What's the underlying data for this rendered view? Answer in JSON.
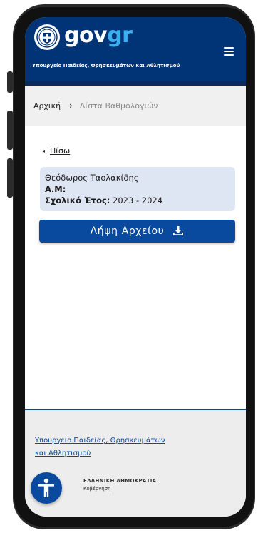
{
  "header": {
    "logo_gov": "gov",
    "logo_gr": "gr",
    "ministry_title": "Υπουργείο Παιδείας, Θρησκευμάτων και Αθλητισμού"
  },
  "breadcrumb": {
    "home": "Αρχική",
    "separator": "›",
    "current": "Λίστα Βαθμολογιών"
  },
  "back": {
    "arrow": "◂",
    "label": "Πίσω"
  },
  "student": {
    "name": "Θεόδωρος Ταολακίδης",
    "am_label": "Α.Μ:",
    "am_value": "",
    "year_label": "Σχολικό Έτος:",
    "year_value": "2023 - 2024"
  },
  "download": {
    "label": "Λήψη Αρχείου",
    "icon": "download-icon"
  },
  "footer": {
    "ministry_link_line1": "Υπουργείο Παιδείας, Θρησκευμάτων",
    "ministry_link_line2": "και Αθλητισμού",
    "org_title": "ΕΛΛΗΝΙΚΗ ΔΗΜΟΚΡΑΤΙΑ",
    "org_subtitle": "Κυβέρνηση"
  },
  "colors": {
    "header_bg": "#003476",
    "accent": "#0a4a9e",
    "logo_gr": "#3ab0f0",
    "card_bg": "#dfe6f3"
  }
}
